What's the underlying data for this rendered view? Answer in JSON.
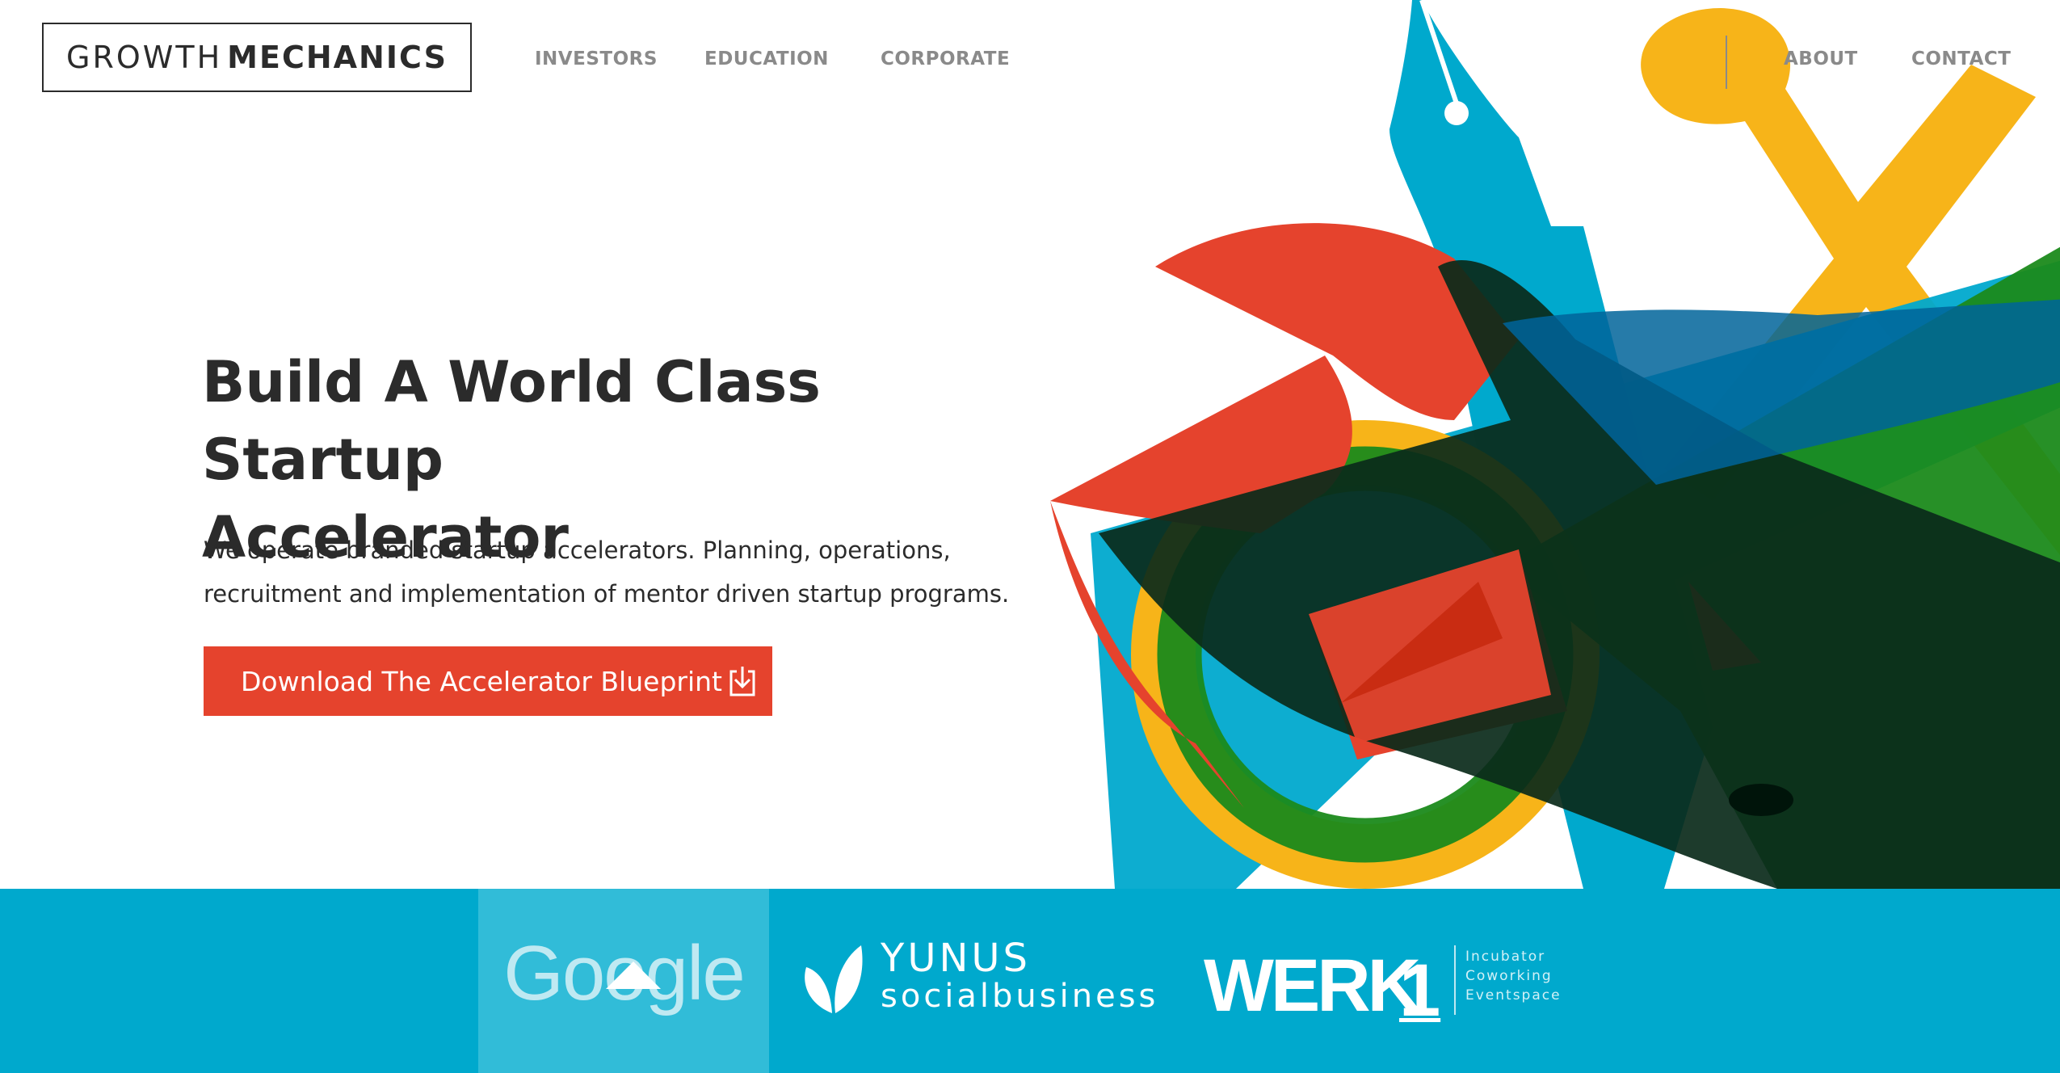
{
  "header": {
    "logo": {
      "part1": "GROWTH",
      "part2": "MECHANICS"
    },
    "nav": {
      "investors": "INVESTORS",
      "education": "EDUCATION",
      "corporate": "CORPORATE",
      "about": "ABOUT",
      "contact": "CONTACT"
    }
  },
  "hero": {
    "headline_line1": "Build A World Class Startup",
    "headline_line2": "Accelerator",
    "subtext_line1": "We operate branded startup accelerators. Planning, operations,",
    "subtext_line2": "recruitment and implementation of mentor driven startup programs.",
    "cta_label": "Download The Accelerator Blueprint",
    "cta_icon": "download-icon"
  },
  "partners": {
    "google": "Google",
    "yunus_name": "YUNUS",
    "yunus_sub": "socialbusiness",
    "werk_name": "WERK",
    "werk_number": "1",
    "werk_tags": [
      "Incubator",
      "Coworking",
      "Eventspace"
    ]
  },
  "colors": {
    "accent_red": "#e5432d",
    "band_blue": "#00a9cd",
    "art_blue": "#00a9cd",
    "art_yellow": "#f7b419",
    "art_green": "#1b8a1b",
    "art_red": "#e5432d",
    "text_dark": "#2b2b2b",
    "nav_gray": "#8a8a8a"
  }
}
